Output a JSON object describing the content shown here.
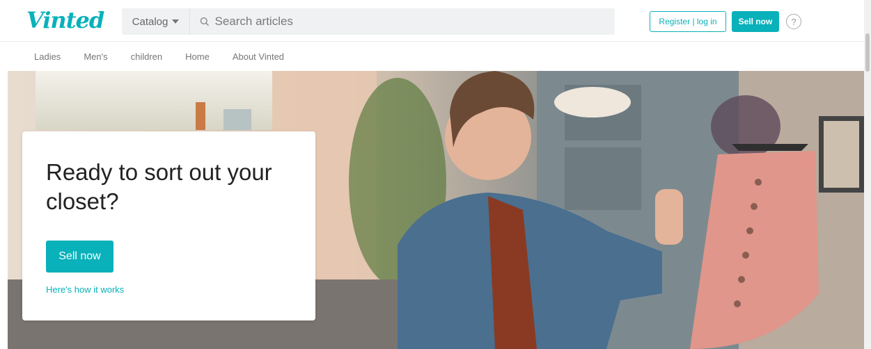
{
  "header": {
    "logo": "Vinted",
    "catalog_label": "Catalog",
    "search_placeholder": "Search articles",
    "register_label": "Register | log in",
    "sell_label": "Sell now",
    "help_glyph": "?"
  },
  "nav": {
    "items": [
      "Ladies",
      "Men's",
      "children",
      "Home",
      "About Vinted"
    ]
  },
  "hero": {
    "title": "Ready to sort out your closet?",
    "sell_button": "Sell now",
    "how_link": "Here's how it works"
  },
  "colors": {
    "accent": "#09b1ba"
  },
  "icons": [
    "search-icon",
    "caret-down-icon",
    "help-icon"
  ]
}
